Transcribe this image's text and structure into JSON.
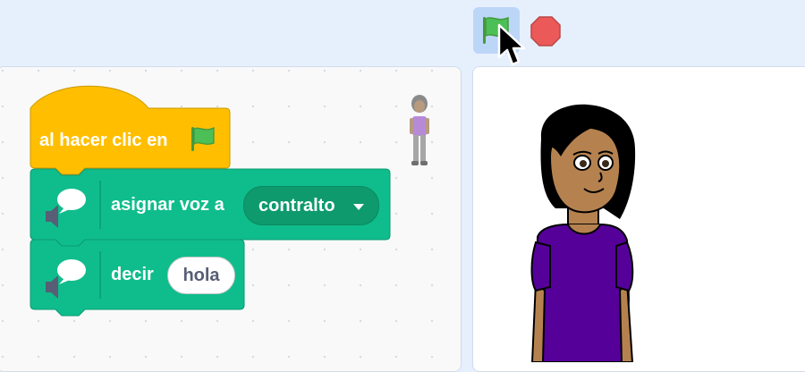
{
  "toolbar": {
    "green_flag_icon": "green-flag-icon",
    "stop_icon": "stop-sign-icon",
    "colors": {
      "flag": "#4cbf56",
      "stop": "#ec5959",
      "flag_active_bg": "#bcd6f8"
    }
  },
  "script": {
    "hat_block": {
      "label": "al hacer clic en",
      "icon": "green-flag-icon",
      "color": "#ffbf00"
    },
    "set_voice_block": {
      "label": "asignar voz a",
      "dropdown_value": "contralto",
      "icon": "speech-bubble-icon",
      "color": "#0fbd8c"
    },
    "say_block": {
      "label": "decir",
      "input_value": "hola",
      "icon": "speech-bubble-icon",
      "color": "#0fbd8c"
    }
  }
}
